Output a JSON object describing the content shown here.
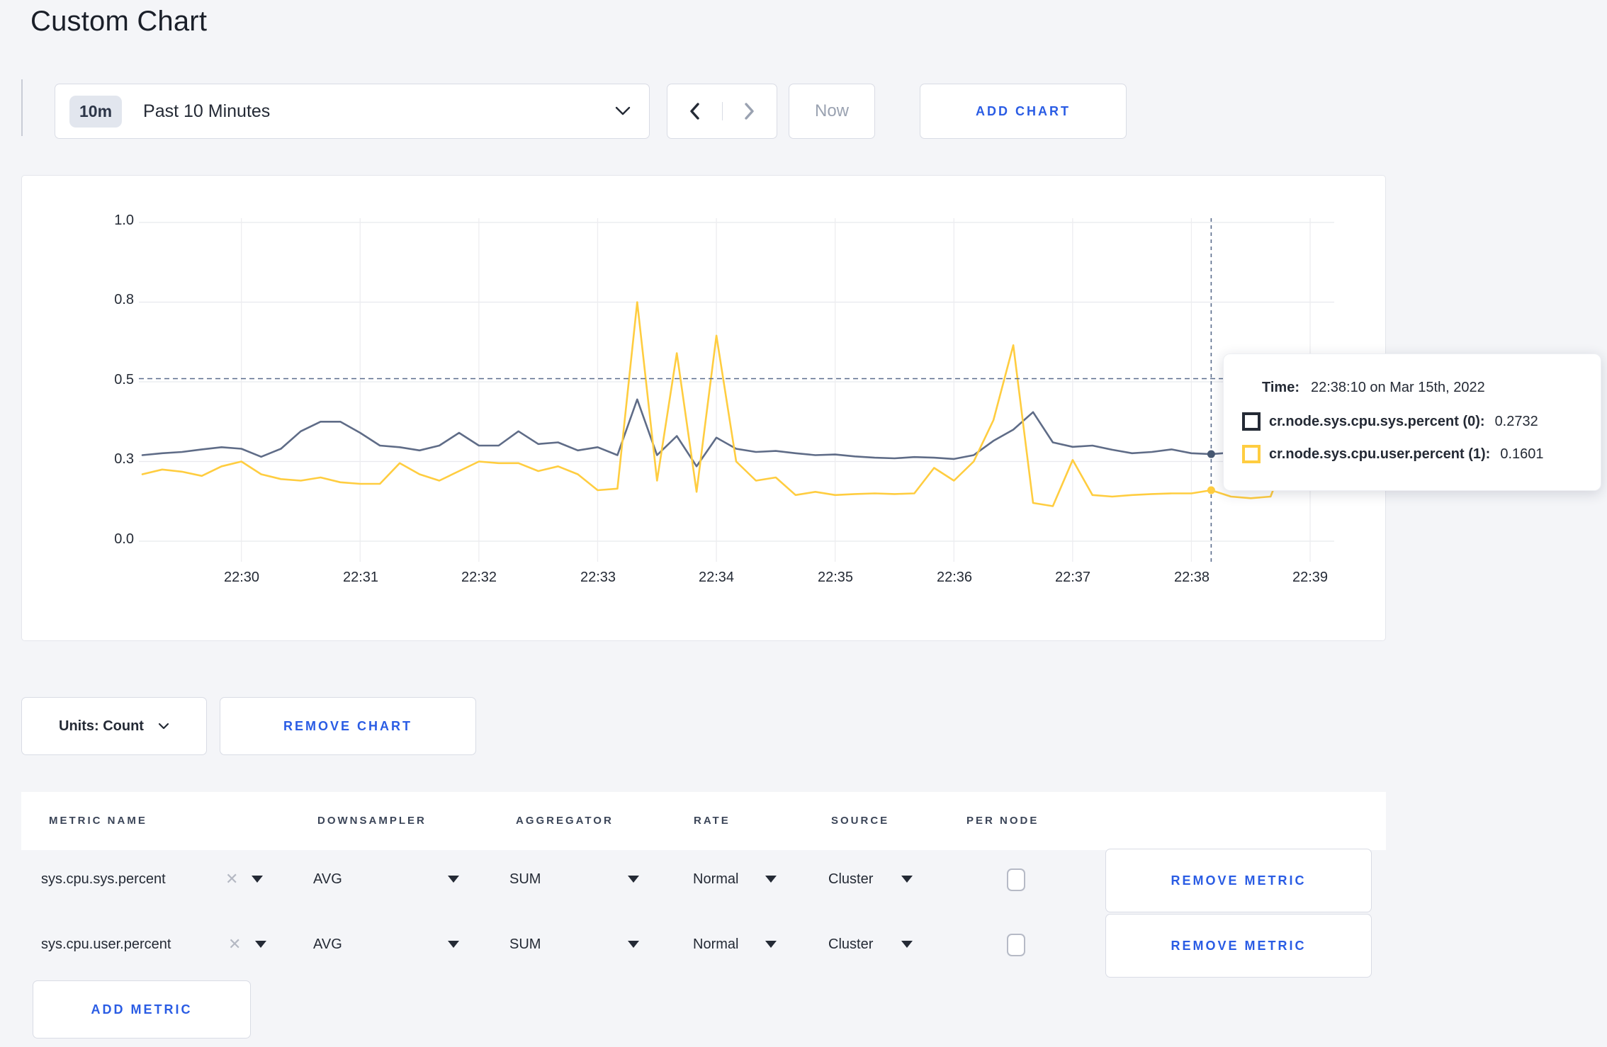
{
  "page": {
    "title": "Custom Chart"
  },
  "toolbar": {
    "time_range": {
      "badge": "10m",
      "label": "Past 10 Minutes"
    },
    "now_label": "Now",
    "add_chart_label": "ADD CHART"
  },
  "chart": {
    "y_ticks": [
      {
        "label": "1.0",
        "value": 1.0
      },
      {
        "label": "0.8",
        "value": 0.75
      },
      {
        "label": "0.5",
        "value": 0.5
      },
      {
        "label": "0.3",
        "value": 0.25
      },
      {
        "label": "0.0",
        "value": 0.0
      }
    ],
    "x_ticks": [
      "22:30",
      "22:31",
      "22:32",
      "22:33",
      "22:34",
      "22:35",
      "22:36",
      "22:37",
      "22:38",
      "22:39"
    ],
    "crosshair": {
      "x_index": 54,
      "h_value": 0.51,
      "sys_value": 0.2732,
      "user_value": 0.1601
    }
  },
  "chart_data": {
    "type": "line",
    "title": "",
    "x_start": "22:29:10",
    "x_end": "22:39:10",
    "interval_seconds": 10,
    "ylim": [
      0,
      1
    ],
    "y_tick_values": [
      0,
      0.25,
      0.5,
      0.75,
      1.0
    ],
    "y_tick_labels": [
      "0.0",
      "0.3",
      "0.5",
      "0.8",
      "1.0"
    ],
    "x_tick_labels": [
      "22:30",
      "22:31",
      "22:32",
      "22:33",
      "22:34",
      "22:35",
      "22:36",
      "22:37",
      "22:38",
      "22:39"
    ],
    "grid": true,
    "legend_position": "tooltip",
    "series": [
      {
        "name": "cr.node.sys.cpu.sys.percent (0)",
        "color": "#5f6c87",
        "values": [
          0.27,
          0.276,
          0.28,
          0.288,
          0.295,
          0.29,
          0.265,
          0.29,
          0.345,
          0.375,
          0.375,
          0.34,
          0.3,
          0.295,
          0.285,
          0.3,
          0.34,
          0.3,
          0.3,
          0.345,
          0.305,
          0.31,
          0.285,
          0.295,
          0.27,
          0.445,
          0.27,
          0.33,
          0.235,
          0.325,
          0.29,
          0.28,
          0.283,
          0.276,
          0.27,
          0.272,
          0.266,
          0.262,
          0.26,
          0.264,
          0.262,
          0.258,
          0.27,
          0.315,
          0.35,
          0.405,
          0.31,
          0.296,
          0.3,
          0.287,
          0.276,
          0.28,
          0.288,
          0.276,
          0.2732,
          0.278,
          0.3,
          0.302,
          0.296,
          0.298,
          0.304
        ]
      },
      {
        "name": "cr.node.sys.cpu.user.percent (1)",
        "color": "#ffcd40",
        "values": [
          0.21,
          0.225,
          0.218,
          0.205,
          0.235,
          0.25,
          0.21,
          0.195,
          0.19,
          0.2,
          0.185,
          0.18,
          0.18,
          0.245,
          0.21,
          0.19,
          0.22,
          0.25,
          0.245,
          0.245,
          0.22,
          0.235,
          0.21,
          0.16,
          0.165,
          0.75,
          0.19,
          0.59,
          0.155,
          0.645,
          0.25,
          0.19,
          0.2,
          0.145,
          0.155,
          0.145,
          0.148,
          0.15,
          0.148,
          0.15,
          0.23,
          0.19,
          0.25,
          0.38,
          0.615,
          0.12,
          0.11,
          0.255,
          0.145,
          0.14,
          0.145,
          0.148,
          0.15,
          0.15,
          0.1601,
          0.14,
          0.135,
          0.14,
          0.3,
          0.22,
          0.27
        ]
      }
    ]
  },
  "tooltip": {
    "time_label": "Time:",
    "time_value": "22:38:10 on Mar 15th, 2022",
    "series": [
      {
        "label": "cr.node.sys.cpu.sys.percent (0):",
        "value": "0.2732",
        "swatch": "#242a35"
      },
      {
        "label": "cr.node.sys.cpu.user.percent (1):",
        "value": "0.1601",
        "swatch": "#ffcd40"
      }
    ]
  },
  "chart_controls": {
    "units_label": "Units: Count",
    "remove_chart_label": "REMOVE CHART"
  },
  "metrics_table": {
    "headers": [
      "METRIC NAME",
      "DOWNSAMPLER",
      "AGGREGATOR",
      "RATE",
      "SOURCE",
      "PER NODE"
    ],
    "rows": [
      {
        "metric": "sys.cpu.sys.percent",
        "downsampler": "AVG",
        "aggregator": "SUM",
        "rate": "Normal",
        "source": "Cluster",
        "per_node_checked": false,
        "remove_label": "REMOVE METRIC"
      },
      {
        "metric": "sys.cpu.user.percent",
        "downsampler": "AVG",
        "aggregator": "SUM",
        "rate": "Normal",
        "source": "Cluster",
        "per_node_checked": false,
        "remove_label": "REMOVE METRIC"
      }
    ],
    "add_metric_label": "ADD METRIC"
  }
}
